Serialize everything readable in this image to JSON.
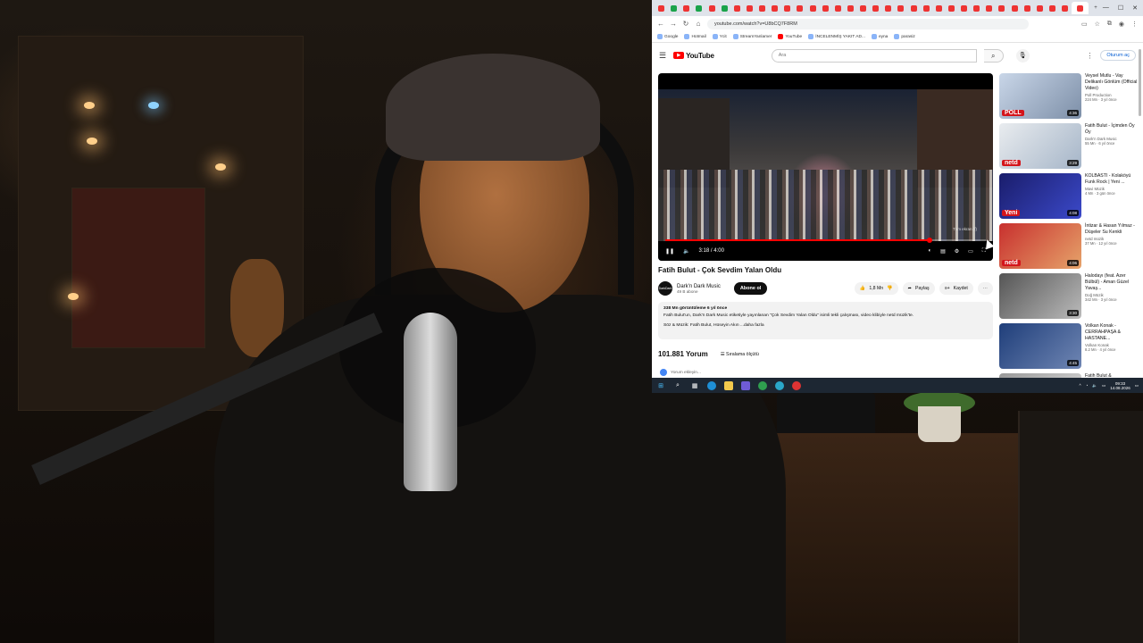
{
  "browser": {
    "tab_count": 34,
    "url": "youtube.com/watch?v=U8bCQ7F8RM",
    "bookmarks": [
      "Google",
      "Hotmail",
      "Ycit",
      "StreamYanlamer",
      "YouTube",
      "İNCELENMİŞ YAKIT AD...",
      "eyna",
      "parasiz"
    ]
  },
  "youtube": {
    "logo": "YouTube",
    "search_placeholder": "Ara",
    "signin": "Oturum aç",
    "player": {
      "time": "3:18 / 4:00",
      "progress": 0.825,
      "overlay": "Tüm ekran (f)"
    },
    "video": {
      "title": "Fatih Bulut - Çok Sevdim Yalan Oldu",
      "channel": "Dark'n Dark Music",
      "channel_avatar": "DarkDark",
      "subscribers": "49 B abone",
      "subscribe": "Abone ol",
      "likes": "1,8 Mn",
      "share": "Paylaş",
      "save": "Kaydet",
      "description_stats": "338 Mn görüntüleme  6 yıl önce",
      "description": "Fatih Bulut'un, Dark'n Dark Music etiketiyle yayınlanan \"Çok Sevdim Yalan Oldu\" isimli tekli çalışması, video klibiyle netd müzik'te.",
      "credits": "Söz & Müzik: Fatih Bulut, Hüseyin Akın ...daha fazla"
    },
    "comments": {
      "count": "101.881 Yorum",
      "sort": "Sıralama ölçütü",
      "add_placeholder": "Yorum ekleyin..."
    },
    "related": [
      {
        "title": "Veysel Mutlu - Vay Delikanlı Gönlüm (Official Video)",
        "channel": "Poll Production",
        "stats": "224 Mn · 3 yıl önce",
        "duration": "4:36",
        "badge": "POLL"
      },
      {
        "title": "Fatih Bulut - İçimden Öy Öy",
        "channel": "Dark'n Dark Music",
        "stats": "55 Mn · 6 yıl önce",
        "duration": "3:29",
        "badge": "netd"
      },
      {
        "title": "KOLBASTI - Kolaköyü Funk Rock | Yeni ...",
        "channel": "Mavi Müzik",
        "stats": "4 Mn · 3 gün önce",
        "duration": "4:08",
        "badge": "Yeni"
      },
      {
        "title": "İntizar & Hasan Yılmaz - Düşeler Su Kenkli",
        "channel": "netd müzik",
        "stats": "37 Mn · 12 yıl önce",
        "duration": "4:06",
        "badge": "netd"
      },
      {
        "title": "Halodayı (feat. Azer Bülbül) - Aman Güzel Yavaş...",
        "channel": "Doğ Müzik",
        "stats": "342 Mn · 3 yıl önce",
        "duration": "3:30",
        "badge": ""
      },
      {
        "title": "Volkan Konak - CERRAHPAŞA & HASTANE...",
        "channel": "Volkan Konak",
        "stats": "8.2 Mn · 4 yıl önce",
        "duration": "4:45",
        "badge": ""
      },
      {
        "title": "Fatih Bulut &",
        "channel": "",
        "stats": "",
        "duration": "",
        "badge": ""
      }
    ]
  },
  "taskbar": {
    "time": "09:33",
    "date": "14.08.2026"
  }
}
